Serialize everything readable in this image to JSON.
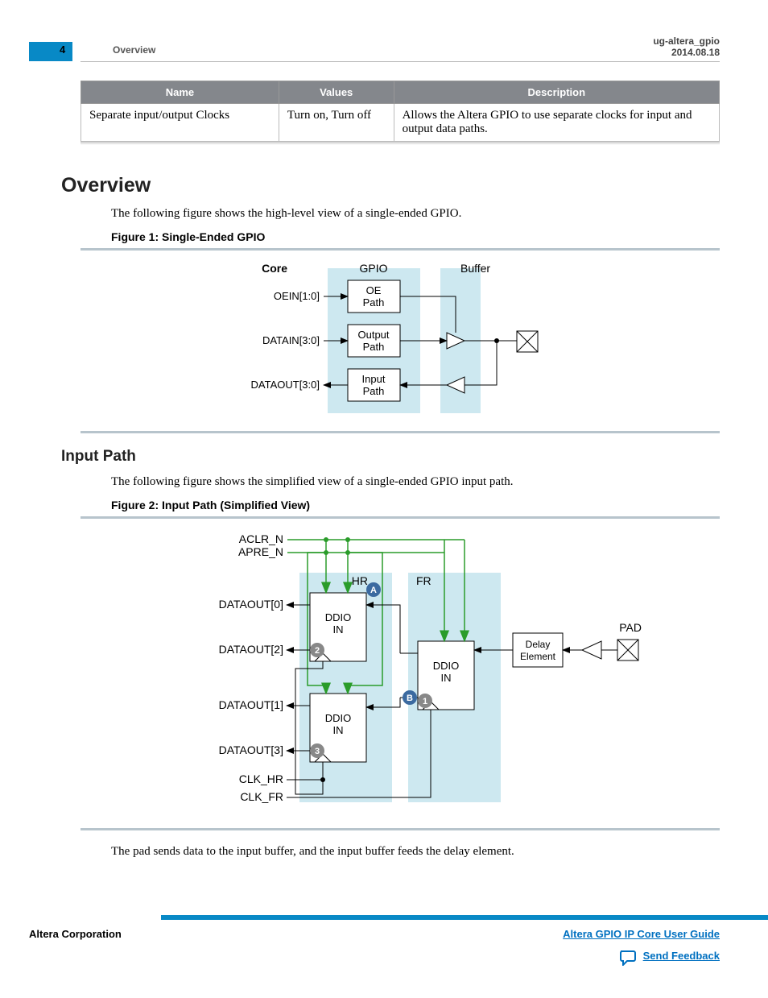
{
  "header": {
    "page_number": "4",
    "breadcrumb": "Overview",
    "doc_id": "ug-altera_gpio",
    "doc_date": "2014.08.18"
  },
  "param_table": {
    "headers": [
      "Name",
      "Values",
      "Description"
    ],
    "row": {
      "name": "Separate input/output Clocks",
      "values": "Turn on, Turn off",
      "desc": "Allows the Altera GPIO to use separate clocks for input and output data paths."
    }
  },
  "overview": {
    "heading": "Overview",
    "lead": "The following figure shows the high-level view of a single-ended GPIO.",
    "figcap": "Figure 1: Single-Ended GPIO"
  },
  "fig1": {
    "col_core": "Core",
    "col_gpio": "GPIO",
    "col_buffer": "Buffer",
    "sig_oein": "OEIN[1:0]",
    "sig_datain": "DATAIN[3:0]",
    "sig_dataout": "DATAOUT[3:0]",
    "blk_oe1": "OE",
    "blk_oe2": "Path",
    "blk_out1": "Output",
    "blk_out2": "Path",
    "blk_in1": "Input",
    "blk_in2": "Path"
  },
  "inputpath": {
    "heading": "Input Path",
    "lead": "The following figure shows the simplified view of a single-ended GPIO input path.",
    "figcap": "Figure 2: Input Path (Simplified View)",
    "tail": "The pad sends data to the input buffer, and the input buffer feeds the delay element."
  },
  "fig2": {
    "aclr": "ACLR_N",
    "apre": "APRE_N",
    "hr": "HR",
    "fr": "FR",
    "pad": "PAD",
    "do0": "DATAOUT[0]",
    "do1": "DATAOUT[1]",
    "do2": "DATAOUT[2]",
    "do3": "DATAOUT[3]",
    "clkhr": "CLK_HR",
    "clkfr": "CLK_FR",
    "ddio1": "DDIO",
    "ddio2": "IN",
    "delay1": "Delay",
    "delay2": "Element",
    "b1": "1",
    "b2": "2",
    "b3": "3",
    "bA": "A",
    "bB": "B"
  },
  "footer": {
    "corp": "Altera Corporation",
    "guide": "Altera GPIO IP Core User Guide",
    "feedback": "Send Feedback"
  }
}
